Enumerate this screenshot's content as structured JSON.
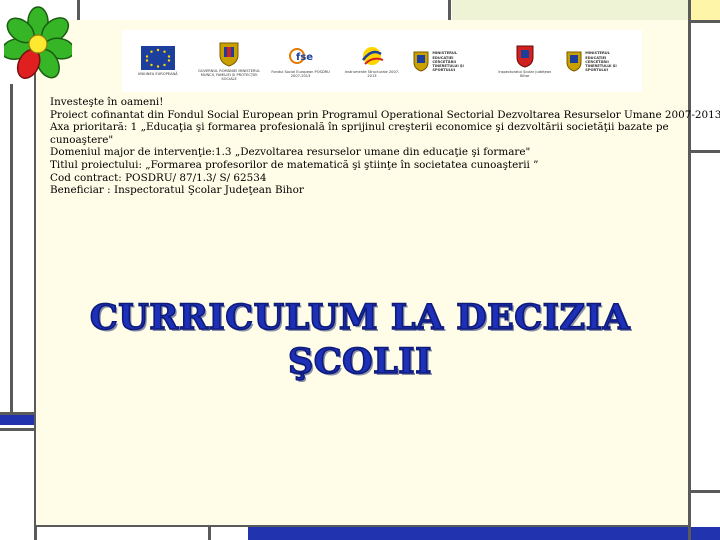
{
  "colors": {
    "panel": "#fffde7",
    "title": "#1e30b8",
    "frame_lines": "#5a5a5a",
    "accent_blue": "#2233b0",
    "accent_yellow": "#fff5a8",
    "accent_green_bg": "#eef3d6"
  },
  "logos": [
    {
      "name": "eu-flag-icon",
      "caption": "UNIUNEA EUROPEANĂ"
    },
    {
      "name": "romania-coat-of-arms-icon",
      "caption": "GUVERNUL ROMÂNIEI MINISTERUL MUNCII, FAMILIEI ȘI PROTECȚIEI SOCIALE"
    },
    {
      "name": "fse-logo-icon",
      "caption": "Fondul Social European POSDRU 2007-2013"
    },
    {
      "name": "instrumente-structurale-icon",
      "caption": "Instrumente Structurale 2007-2013"
    },
    {
      "name": "ministry-education-icon",
      "caption": "MINISTERUL EDUCAȚIEI CERCETĂRII TINERETULUI ȘI SPORTULUI"
    },
    {
      "name": "isj-bihor-icon",
      "caption": "Inspectoratul Școlar Județean Bihor"
    },
    {
      "name": "ministry-education-2-icon",
      "caption": "MINISTERUL EDUCAȚIEI CERCETĂRII TINERETULUI ȘI SPORTULUI"
    }
  ],
  "info": {
    "line1": "Investeşte în  oameni!",
    "line2": "Proiect cofinantat din Fondul Social European prin Programul Operational Sectorial Dezvoltarea Resurselor Umane 2007-2013",
    "line3": "Axa prioritară: 1 „Educaţia şi formarea profesională în sprijinul creşterii economice şi dezvoltării societăţii      bazate   pe cunoaştere\"",
    "line4": "Domeniul major de intervenţie:1.3 „Dezvoltarea resurselor umane din educaţie şi formare\"",
    "line5": "Titlul proiectului: „Formarea profesorilor de matematică şi ştiinţe în societatea cunoaşterii ”",
    "line6": "Cod contract: POSDRU/ 87/1.3/ S/ 62534",
    "line7": "Beneficiar : Inspectoratul Şcolar Judeţean Bihor"
  },
  "title": {
    "line1": "CURRICULUM LA DECIZIA",
    "line2": "ŞCOLII"
  }
}
